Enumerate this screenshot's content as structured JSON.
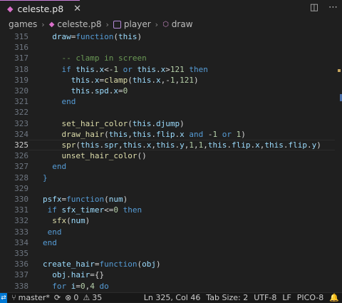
{
  "tab": {
    "title": "celeste.p8",
    "close": "✕",
    "icon": "pico8-icon"
  },
  "breadcrumb": [
    "games",
    "celeste.p8",
    "player",
    "draw"
  ],
  "editor": {
    "lines": [
      {
        "n": "315",
        "segs": [
          [
            "",
            "  "
          ],
          [
            "var",
            "draw"
          ],
          [
            "",
            "="
          ],
          [
            "kw",
            "function"
          ],
          [
            "",
            "("
          ],
          [
            "var",
            "this"
          ],
          [
            "",
            ")"
          ]
        ]
      },
      {
        "n": "316",
        "segs": []
      },
      {
        "n": "317",
        "segs": [
          [
            "",
            "    "
          ],
          [
            "cm",
            "-- clamp in screen"
          ]
        ]
      },
      {
        "n": "318",
        "segs": [
          [
            "",
            "    "
          ],
          [
            "kw",
            "if "
          ],
          [
            "var",
            "this"
          ],
          [
            "",
            "."
          ],
          [
            "var",
            "x"
          ],
          [
            "",
            "<-"
          ],
          [
            "num",
            "1"
          ],
          [
            "kw",
            " or "
          ],
          [
            "var",
            "this"
          ],
          [
            "",
            "."
          ],
          [
            "var",
            "x"
          ],
          [
            "",
            ">"
          ],
          [
            "num",
            "121"
          ],
          [
            "kw",
            " then"
          ]
        ]
      },
      {
        "n": "319",
        "segs": [
          [
            "",
            "      "
          ],
          [
            "var",
            "this"
          ],
          [
            "",
            "."
          ],
          [
            "var",
            "x"
          ],
          [
            "",
            "="
          ],
          [
            "fn",
            "clamp"
          ],
          [
            "",
            "("
          ],
          [
            "var",
            "this"
          ],
          [
            "",
            "."
          ],
          [
            "var",
            "x"
          ],
          [
            "",
            ",-"
          ],
          [
            "num",
            "1"
          ],
          [
            "",
            ","
          ],
          [
            "num",
            "121"
          ],
          [
            "",
            ")"
          ]
        ]
      },
      {
        "n": "320",
        "segs": [
          [
            "",
            "      "
          ],
          [
            "var",
            "this"
          ],
          [
            "",
            "."
          ],
          [
            "var",
            "spd"
          ],
          [
            "",
            "."
          ],
          [
            "var",
            "x"
          ],
          [
            "",
            "="
          ],
          [
            "num",
            "0"
          ]
        ]
      },
      {
        "n": "321",
        "segs": [
          [
            "",
            "    "
          ],
          [
            "kw",
            "end"
          ]
        ]
      },
      {
        "n": "322",
        "segs": []
      },
      {
        "n": "323",
        "segs": [
          [
            "",
            "    "
          ],
          [
            "fn",
            "set_hair_color"
          ],
          [
            "",
            "("
          ],
          [
            "var",
            "this"
          ],
          [
            "",
            "."
          ],
          [
            "var",
            "djump"
          ],
          [
            "",
            ")"
          ]
        ]
      },
      {
        "n": "324",
        "segs": [
          [
            "",
            "    "
          ],
          [
            "fn",
            "draw_hair"
          ],
          [
            "",
            "("
          ],
          [
            "var",
            "this"
          ],
          [
            "",
            ","
          ],
          [
            "var",
            "this"
          ],
          [
            "",
            "."
          ],
          [
            "var",
            "flip"
          ],
          [
            "",
            "."
          ],
          [
            "var",
            "x"
          ],
          [
            "kw",
            " and "
          ],
          [
            "",
            "-"
          ],
          [
            "num",
            "1"
          ],
          [
            "kw",
            " or "
          ],
          [
            "num",
            "1"
          ],
          [
            "",
            ")"
          ]
        ]
      },
      {
        "n": "325",
        "segs": [
          [
            "",
            "    "
          ],
          [
            "fn",
            "spr"
          ],
          [
            "",
            "("
          ],
          [
            "var",
            "this"
          ],
          [
            "",
            "."
          ],
          [
            "var",
            "spr"
          ],
          [
            "",
            ","
          ],
          [
            "var",
            "this"
          ],
          [
            "",
            "."
          ],
          [
            "var",
            "x"
          ],
          [
            "",
            ","
          ],
          [
            "var",
            "this"
          ],
          [
            "",
            "."
          ],
          [
            "var",
            "y"
          ],
          [
            "",
            ","
          ],
          [
            "num",
            "1"
          ],
          [
            "",
            ","
          ],
          [
            "num",
            "1"
          ],
          [
            "",
            ","
          ],
          [
            "var",
            "this"
          ],
          [
            "",
            "."
          ],
          [
            "var",
            "flip"
          ],
          [
            "",
            "."
          ],
          [
            "var",
            "x"
          ],
          [
            "",
            ","
          ],
          [
            "var",
            "this"
          ],
          [
            "",
            "."
          ],
          [
            "var",
            "flip"
          ],
          [
            "",
            "."
          ],
          [
            "var",
            "y"
          ],
          [
            "",
            ")"
          ]
        ]
      },
      {
        "n": "326",
        "segs": [
          [
            "",
            "    "
          ],
          [
            "fn",
            "unset_hair_color"
          ],
          [
            "",
            "()"
          ]
        ]
      },
      {
        "n": "327",
        "segs": [
          [
            "",
            "  "
          ],
          [
            "kw",
            "end"
          ]
        ]
      },
      {
        "n": "328",
        "segs": [
          [
            "kw",
            "}"
          ]
        ]
      },
      {
        "n": "329",
        "segs": []
      },
      {
        "n": "330",
        "segs": [
          [
            "var",
            "psfx"
          ],
          [
            "",
            "="
          ],
          [
            "kw",
            "function"
          ],
          [
            "",
            "("
          ],
          [
            "var",
            "num"
          ],
          [
            "",
            ")"
          ]
        ]
      },
      {
        "n": "331",
        "segs": [
          [
            "",
            ""
          ],
          [
            "kw",
            " if "
          ],
          [
            "var",
            "sfx_timer"
          ],
          [
            "",
            "<="
          ],
          [
            "num",
            "0"
          ],
          [
            "kw",
            " then"
          ]
        ]
      },
      {
        "n": "332",
        "segs": [
          [
            "",
            "  "
          ],
          [
            "fn",
            "sfx"
          ],
          [
            "",
            "("
          ],
          [
            "var",
            "num"
          ],
          [
            "",
            ")"
          ]
        ]
      },
      {
        "n": "333",
        "segs": [
          [
            "",
            ""
          ],
          [
            "kw",
            " end"
          ]
        ]
      },
      {
        "n": "334",
        "segs": [
          [
            "kw",
            "end"
          ]
        ]
      },
      {
        "n": "335",
        "segs": []
      },
      {
        "n": "336",
        "segs": [
          [
            "var",
            "create_hair"
          ],
          [
            "",
            "="
          ],
          [
            "kw",
            "function"
          ],
          [
            "",
            "("
          ],
          [
            "var",
            "obj"
          ],
          [
            "",
            ")"
          ]
        ]
      },
      {
        "n": "337",
        "segs": [
          [
            "",
            "  "
          ],
          [
            "var",
            "obj"
          ],
          [
            "",
            "."
          ],
          [
            "var",
            "hair"
          ],
          [
            "",
            "={}"
          ]
        ]
      },
      {
        "n": "338",
        "segs": [
          [
            "",
            "  "
          ],
          [
            "kw",
            "for "
          ],
          [
            "var",
            "i"
          ],
          [
            "",
            "="
          ],
          [
            "num",
            "0"
          ],
          [
            "",
            ","
          ],
          [
            "num",
            "4"
          ],
          [
            "kw",
            " do"
          ]
        ]
      }
    ],
    "current_line": "325"
  },
  "status": {
    "branch": "master*",
    "errors": "0",
    "warnings": "35",
    "position": "Ln 325, Col 46",
    "tab_size": "Tab Size: 2",
    "encoding": "UTF-8",
    "eol": "LF",
    "language": "PICO-8"
  },
  "colors": {
    "accent": "#0078d4",
    "tab_border": "#c87dd6"
  }
}
